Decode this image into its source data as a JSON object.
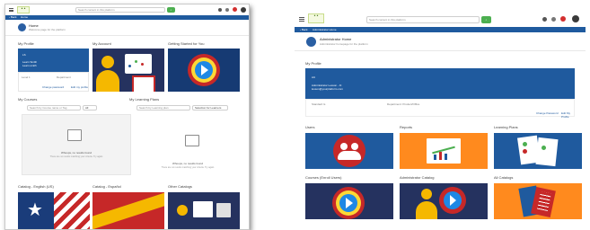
{
  "left": {
    "search_placeholder": "Search content in this platform",
    "search_button": "Go",
    "nav_back": "Back",
    "nav_home": "Home",
    "header_title": "Home",
    "header_subtitle": "Welcome page for the platform",
    "sections": {
      "profile": "My Profile",
      "account": "My Account",
      "getting_started": "Getting Started for You",
      "courses": "My Courses",
      "learning_plans": "My Learning Plans",
      "catalog_english": "Catalog - English (US)",
      "catalog_espanol": "Catalog - Español",
      "other_catalogs": "Other Catalogs"
    },
    "profile": {
      "initials": "LS",
      "name": "Learn Smith",
      "username": "Learn.smith",
      "field1": "Level 1",
      "field2": "Department",
      "action1": "Change password",
      "action2": "Edit my profile"
    },
    "courses_search_placeholder": "Search by Course name or Tag",
    "courses_filter": "All",
    "lp_search_placeholder": "Search by Learning plan",
    "lp_filter": "Selection for Learners",
    "empty_title": "Whoops, no results found",
    "empty_subtitle": "There are no results matching your criteria. Try again"
  },
  "right": {
    "search_placeholder": "Search content in this platform",
    "search_button": "Go",
    "nav_back": "Back",
    "nav_title": "Administrator Home",
    "header_title": "Administrator Home",
    "header_subtitle": "Administrator homepage for the platform",
    "profile_section": "My Profile",
    "profile": {
      "initials": "AU",
      "name": "Administrator Lesson - Fi",
      "email": "lesson@yourplatform.com",
      "field1": "Standard Is",
      "field2": "Department: Product/Office",
      "action1": "Change Password",
      "action2": "Edit My Profile"
    },
    "tiles": [
      "Users",
      "Reports",
      "Learning Plans",
      "Courses (Enroll Users)",
      "Administrator Catalog",
      "All Catalogs"
    ]
  },
  "colors": {
    "brand_blue": "#1f5a9e",
    "dark_navy": "#25325f",
    "accent_green": "#4caf50",
    "tile_red": "#c62828",
    "tile_orange": "#ff8a1e"
  }
}
